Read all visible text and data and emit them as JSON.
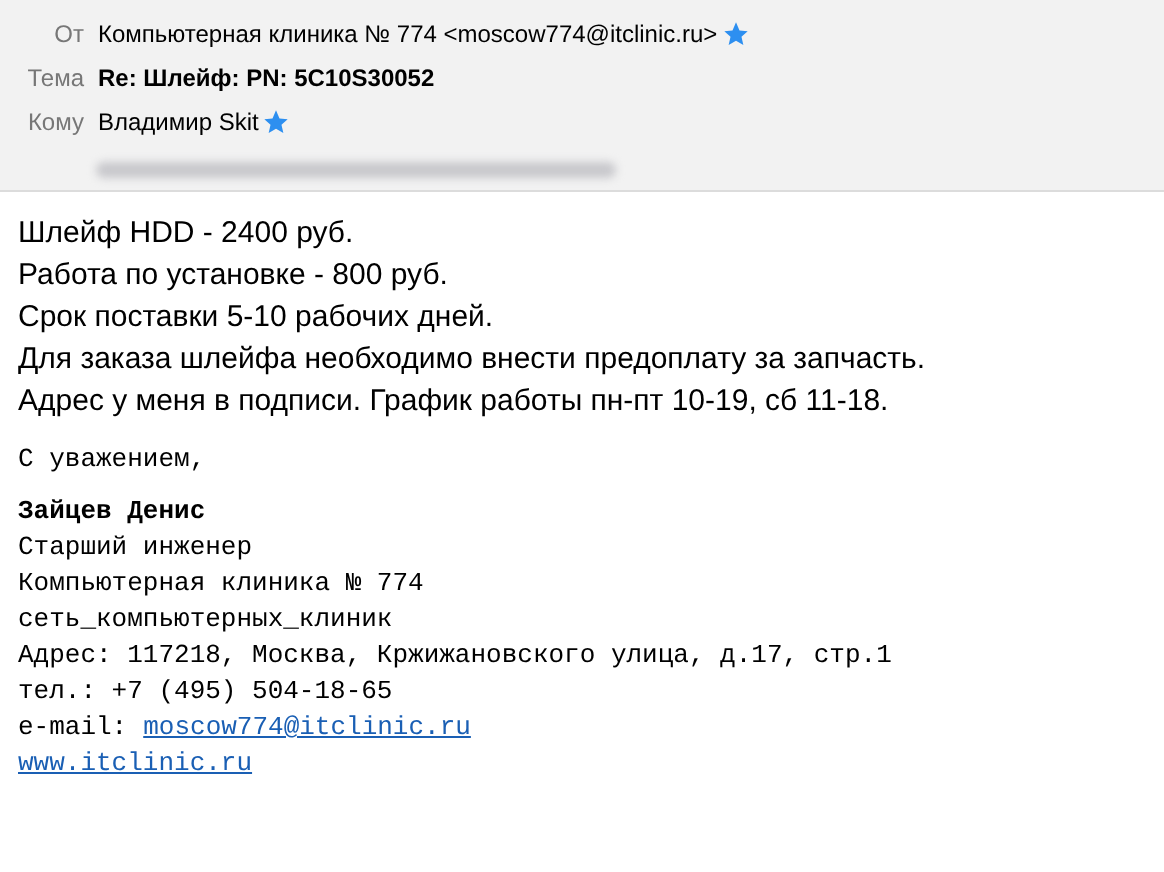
{
  "header": {
    "fields": [
      {
        "label": "От",
        "value": "Компьютерная клиника № 774 <moscow774@itclinic.ru>",
        "bold": false,
        "starred": true
      },
      {
        "label": "Тема",
        "value": "Re: Шлейф: PN: 5C10S30052",
        "bold": true,
        "starred": false
      },
      {
        "label": "Кому",
        "value": "Владимир Skit",
        "bold": false,
        "starred": true
      }
    ]
  },
  "body": {
    "paragraphs": [
      "Шлейф HDD - 2400 руб.",
      "Работа по установке - 800 руб.",
      "Срок поставки 5-10 рабочих дней.",
      "Для заказа шлейфа необходимо внести предоплату за запчасть.",
      "Адрес у меня в подписи. График работы пн-пт 10-19, сб 11-18."
    ],
    "signature": [
      {
        "kind": "text",
        "text": "С уважением,"
      },
      {
        "kind": "gap"
      },
      {
        "kind": "bold",
        "text": "Зайцев Денис"
      },
      {
        "kind": "text",
        "text": "Старший инженер"
      },
      {
        "kind": "text",
        "text": "Компьютерная клиника № 774"
      },
      {
        "kind": "text",
        "text": "сеть_компьютерных_клиник"
      },
      {
        "kind": "text",
        "text": "Адрес: 117218, Москва, Кржижановского улица, д.17, стр.1"
      },
      {
        "kind": "text",
        "text": "тел.: +7 (495) 504-18-65"
      },
      {
        "kind": "labeled-link",
        "text": "e-mail:",
        "link": "moscow774@itclinic.ru"
      },
      {
        "kind": "link",
        "link": "www.itclinic.ru"
      }
    ]
  }
}
